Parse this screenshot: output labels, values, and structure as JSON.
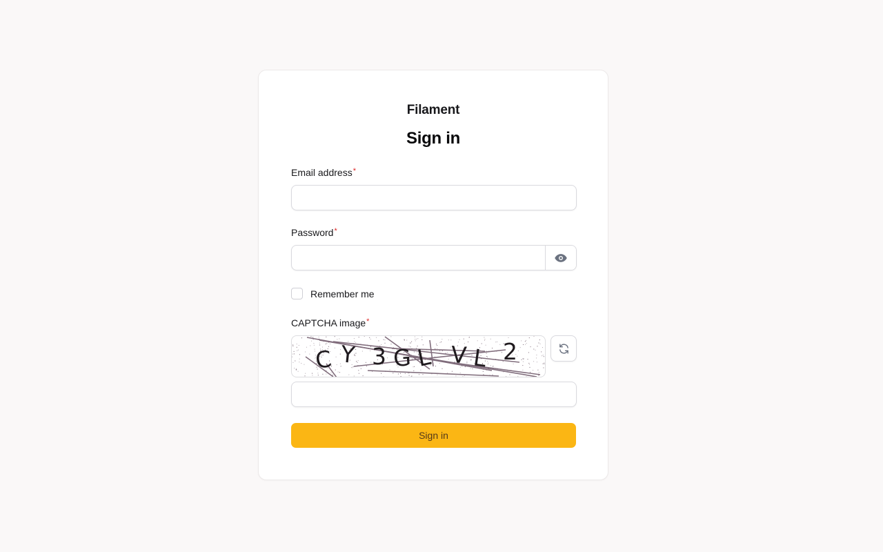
{
  "brand": "Filament",
  "heading": "Sign in",
  "email": {
    "label": "Email address",
    "required_mark": "*",
    "value": ""
  },
  "password": {
    "label": "Password",
    "required_mark": "*",
    "value": "",
    "toggle_icon": "eye-icon"
  },
  "remember": {
    "label": "Remember me",
    "checked": false
  },
  "captcha": {
    "label": "CAPTCHA image",
    "required_mark": "*",
    "chars": [
      "C",
      "Y",
      "3",
      "G",
      "L",
      "V",
      "L",
      "2"
    ],
    "refresh_icon": "refresh-icon",
    "value": ""
  },
  "submit_label": "Sign in",
  "colors": {
    "primary": "#fbb614",
    "primary_text": "#52381a",
    "required": "#dc2626",
    "captcha_ink": "#6b5466"
  }
}
